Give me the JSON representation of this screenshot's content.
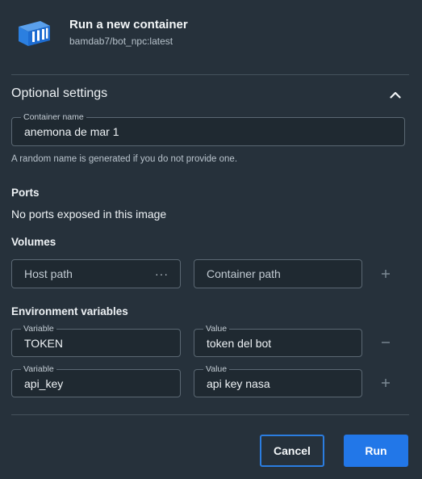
{
  "header": {
    "title": "Run a new container",
    "subtitle": "bamdab7/bot_npc:latest",
    "logo_icon": "container-icon"
  },
  "optional": {
    "heading": "Optional settings",
    "collapse_icon": "chevron-up-icon"
  },
  "container_name": {
    "label": "Container name",
    "value": "anemona de mar 1",
    "help": "A random name is generated if you do not provide one."
  },
  "ports": {
    "heading": "Ports",
    "message": "No ports exposed in this image"
  },
  "volumes": {
    "heading": "Volumes",
    "host_placeholder": "Host path",
    "host_menu_icon": "ellipsis-icon",
    "host_menu": "···",
    "container_placeholder": "Container path",
    "add_icon": "plus-icon"
  },
  "env": {
    "heading": "Environment variables",
    "rows": [
      {
        "variable_label": "Variable",
        "variable": "TOKEN",
        "value_label": "Value",
        "value": "token del bot",
        "action_icon": "minus-icon"
      },
      {
        "variable_label": "Variable",
        "variable": "api_key",
        "value_label": "Value",
        "value": "api key nasa",
        "action_icon": "plus-icon"
      }
    ]
  },
  "actions": {
    "cancel": "Cancel",
    "run": "Run"
  },
  "colors": {
    "background": "#26313b",
    "accent": "#2277e8",
    "field_border": "#5b6873"
  }
}
